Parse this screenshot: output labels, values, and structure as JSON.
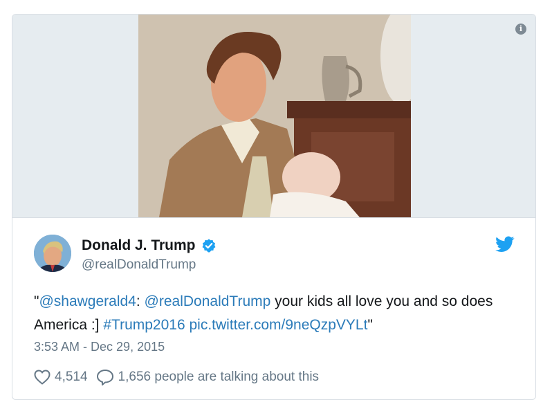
{
  "media": {
    "image_icon": "photo-of-man-holding-baby",
    "info_icon": "info-icon"
  },
  "author": {
    "name": "Donald J. Trump",
    "handle": "@realDonaldTrump",
    "verified": true
  },
  "tweet": {
    "prefix": "\"",
    "mention1": "@shawgerald4",
    "colon": ": ",
    "mention2": "@realDonaldTrump",
    "body": " your kids all love you and so does America :] ",
    "hashtag": "#Trump2016",
    "space": " ",
    "link": "pic.twitter.com/9neQzpVYLt",
    "suffix": "\""
  },
  "timestamp": "3:53 AM - Dec 29, 2015",
  "actions": {
    "likes": "4,514",
    "talking": "1,656 people are talking about this"
  },
  "colors": {
    "link": "#2b7bb9",
    "verified": "#1da1f2",
    "bird": "#1da1f2",
    "muted": "#657786"
  }
}
